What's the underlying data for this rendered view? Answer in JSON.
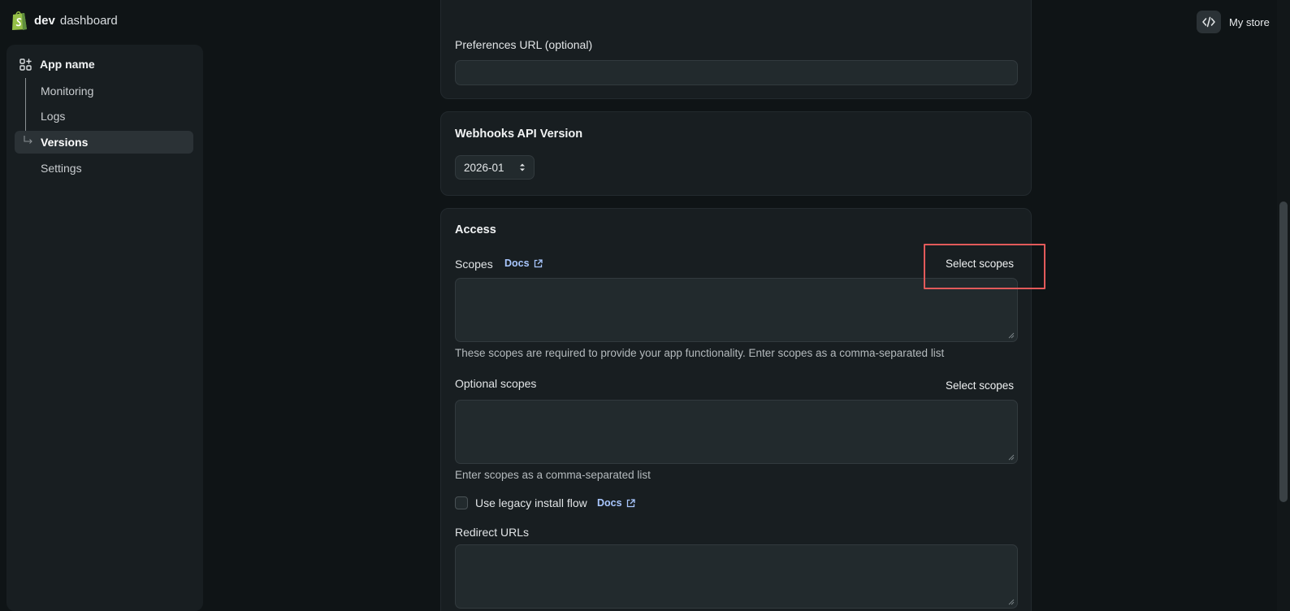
{
  "header": {
    "brand_bold": "dev",
    "brand_rest": "dashboard",
    "store_label": "My store"
  },
  "sidebar": {
    "app_name": "App name",
    "items": [
      {
        "label": "Monitoring"
      },
      {
        "label": "Logs"
      },
      {
        "label": "Versions"
      },
      {
        "label": "Settings"
      }
    ]
  },
  "main": {
    "preferences_label": "Preferences URL (optional)",
    "webhooks": {
      "title": "Webhooks API Version",
      "selected_version": "2026-01"
    },
    "access": {
      "title": "Access",
      "scopes_label": "Scopes",
      "docs_label": "Docs",
      "select_scopes_label": "Select scopes",
      "scopes_help": "These scopes are required to provide your app functionality. Enter scopes as a comma-separated list",
      "optional_label": "Optional scopes",
      "optional_select_label": "Select scopes",
      "optional_help": "Enter scopes as a comma-separated list",
      "legacy_label": "Use legacy install flow",
      "legacy_docs_label": "Docs",
      "redirect_label": "Redirect URLs"
    }
  },
  "colors": {
    "background": "#0f1416",
    "card": "#181e21",
    "link": "#a9c7ff",
    "highlight": "#e25a5a",
    "brand_green": "#95bf47"
  }
}
